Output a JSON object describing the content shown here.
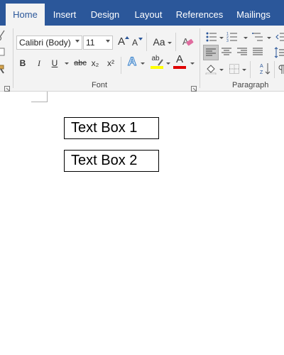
{
  "tabs": [
    "Home",
    "Insert",
    "Design",
    "Layout",
    "References",
    "Mailings"
  ],
  "active_tab": "Home",
  "font_group": {
    "label": "Font",
    "font_name": "Calibri (Body)",
    "font_size": "11",
    "grow_label": "A",
    "shrink_label": "A",
    "case_label": "Aa",
    "bold": "B",
    "italic": "I",
    "underline": "U",
    "strikethrough": "abc",
    "subscript": "x₂",
    "superscript": "x²",
    "text_effects": "A",
    "highlight_label": "ab",
    "font_color_label": "A",
    "highlight_color": "#ffff00",
    "font_color": "#e00000"
  },
  "paragraph_group": {
    "label": "Paragraph"
  },
  "document": {
    "textbox_1": "Text Box 1",
    "textbox_2": "Text Box 2"
  },
  "colors": {
    "ribbon_accent": "#2b579a",
    "ribbon_background": "#f3f3f3"
  }
}
